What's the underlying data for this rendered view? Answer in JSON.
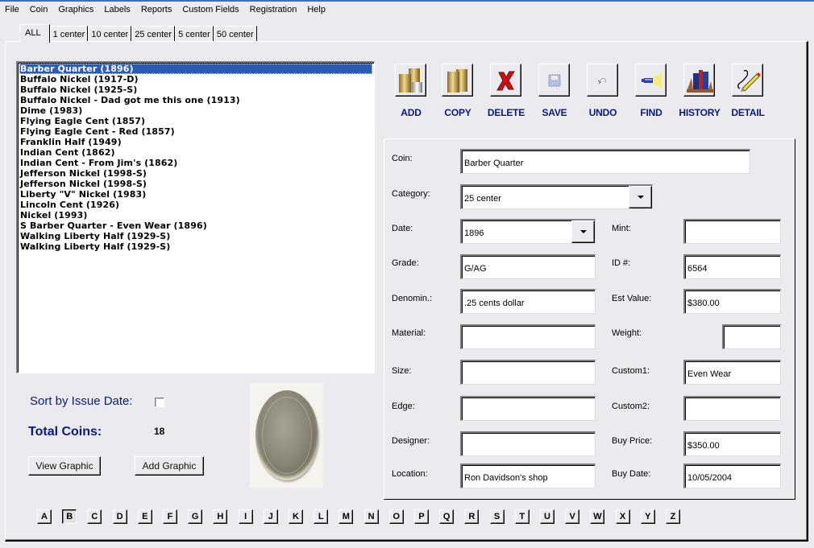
{
  "menu": [
    "File",
    "Coin",
    "Graphics",
    "Labels",
    "Reports",
    "Custom Fields",
    "Registration",
    "Help"
  ],
  "tabs": [
    {
      "label": "ALL",
      "active": true
    },
    {
      "label": "1 center",
      "active": false
    },
    {
      "label": "10 center",
      "active": false
    },
    {
      "label": "25 center",
      "active": false
    },
    {
      "label": "5 center",
      "active": false
    },
    {
      "label": "50 center",
      "active": false
    }
  ],
  "coin_list": {
    "selected_index": 0,
    "items": [
      "Barber Quarter (1896)",
      "Buffalo Nickel (1917-D)",
      "Buffalo Nickel (1925-S)",
      "Buffalo Nickel - Dad got me this one (1913)",
      "Dime (1983)",
      "Flying Eagle Cent (1857)",
      "Flying Eagle Cent - Red (1857)",
      "Franklin Half (1949)",
      "Indian Cent (1862)",
      "Indian Cent - From Jim's (1862)",
      "Jefferson Nickel (1998-S)",
      "Jefferson Nickel (1998-S)",
      "Liberty \"V\" Nickel (1983)",
      "Lincoln Cent (1926)",
      "Nickel (1993)",
      "S Barber Quarter - Even Wear (1896)",
      "Walking Liberty Half (1929-S)",
      "Walking Liberty Half (1929-S)"
    ]
  },
  "sort": {
    "label": "Sort by Issue Date:",
    "checked": false
  },
  "total": {
    "label": "Total Coins:",
    "value": "18"
  },
  "graphic_buttons": {
    "view": "View Graphic",
    "add": "Add Graphic"
  },
  "toolbar": [
    {
      "label": "ADD",
      "icon": "coins-add-icon"
    },
    {
      "label": "COPY",
      "icon": "coins-copy-icon"
    },
    {
      "label": "DELETE",
      "icon": "red-x-icon"
    },
    {
      "label": "SAVE",
      "icon": "floppy-disk-icon"
    },
    {
      "label": "UNDO",
      "icon": "undo-arrow-icon"
    },
    {
      "label": "FIND",
      "icon": "flashlight-icon"
    },
    {
      "label": "HISTORY",
      "icon": "books-icon"
    },
    {
      "label": "DETAIL",
      "icon": "pencil-icon"
    }
  ],
  "fields": {
    "coin": {
      "label": "Coin:",
      "value": "Barber Quarter"
    },
    "category": {
      "label": "Category:",
      "value": "25 center"
    },
    "date": {
      "label": "Date:",
      "value": "1896"
    },
    "mint": {
      "label": "Mint:",
      "value": ""
    },
    "grade": {
      "label": "Grade:",
      "value": "G/AG"
    },
    "id": {
      "label": "ID #:",
      "value": "6564"
    },
    "denomination": {
      "label": "Denomin.:",
      "value": ".25 cents dollar"
    },
    "est_value": {
      "label": "Est Value:",
      "value": "$380.00"
    },
    "material": {
      "label": "Material:",
      "value": ""
    },
    "weight": {
      "label": "Weight:",
      "value": ""
    },
    "size": {
      "label": "Size:",
      "value": ""
    },
    "custom1": {
      "label": "Custom1:",
      "value": "Even Wear"
    },
    "edge": {
      "label": "Edge:",
      "value": ""
    },
    "custom2": {
      "label": "Custom2:",
      "value": ""
    },
    "designer": {
      "label": "Designer:",
      "value": ""
    },
    "buy_price": {
      "label": "Buy Price:",
      "value": "$350.00"
    },
    "location": {
      "label": "Location:",
      "value": "Ron Davidson's shop"
    },
    "buy_date": {
      "label": "Buy Date:",
      "value": "10/05/2004"
    }
  },
  "alphabet": {
    "pressed": "B",
    "letters": [
      "A",
      "B",
      "C",
      "D",
      "E",
      "F",
      "G",
      "H",
      "I",
      "J",
      "K",
      "L",
      "M",
      "N",
      "O",
      "P",
      "Q",
      "R",
      "S",
      "T",
      "U",
      "V",
      "W",
      "X",
      "Y",
      "Z"
    ]
  },
  "colors": {
    "accent_label": "#0a1a7c",
    "selection": "#2a5bb5"
  }
}
